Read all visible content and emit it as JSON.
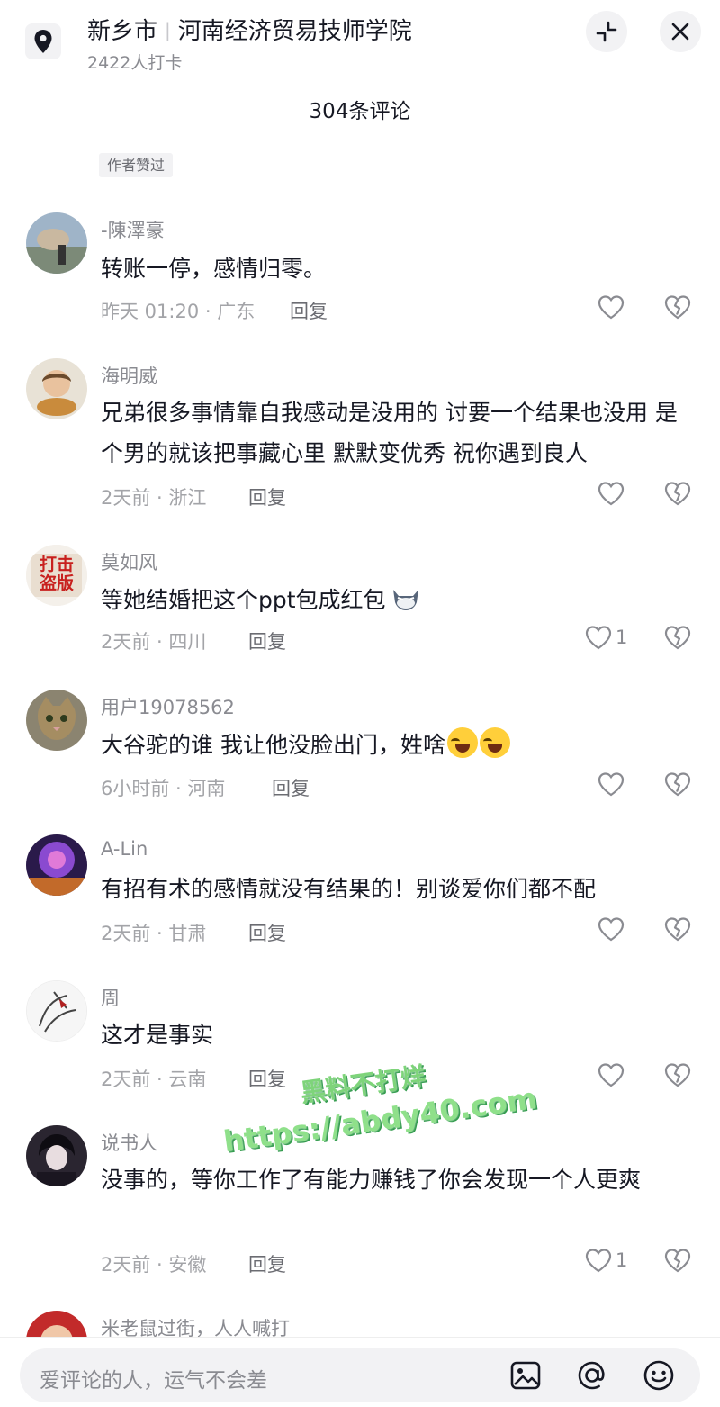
{
  "header": {
    "city": "新乡市",
    "place": "河南经济贸易技师学院",
    "checkins": "2422人打卡",
    "comment_count": "304条评论"
  },
  "author_liked_badge": "作者赞过",
  "comments": [
    {
      "user": "-陳澤豪",
      "text": "转账一停，感情归零。",
      "meta": "昨天 01:20 · 广东",
      "reply": "回复",
      "likes": ""
    },
    {
      "user": "海明威",
      "text": "兄弟很多事情靠自我感动是没用的 讨要一个结果也没用 是个男的就该把事藏心里 默默变优秀 祝你遇到良人",
      "meta": "2天前 · 浙江",
      "reply": "回复",
      "likes": ""
    },
    {
      "user": "莫如风",
      "text": "等她结婚把这个ppt包成红包",
      "meta": "2天前 · 四川",
      "reply": "回复",
      "likes": "1"
    },
    {
      "user": "用户19078562",
      "text": "大谷驼的谁 我让他没脸出门，姓啥",
      "meta": "6小时前 · 河南",
      "reply": "回复",
      "likes": ""
    },
    {
      "user": "A-Lin",
      "text": "有招有术的感情就没有结果的！别谈爱你们都不配",
      "meta": "2天前 · 甘肃",
      "reply": "回复",
      "likes": ""
    },
    {
      "user": "周",
      "text": "这才是事实",
      "meta": "2天前 · 云南",
      "reply": "回复",
      "likes": ""
    },
    {
      "user": "说书人",
      "text": "没事的，等你工作了有能力赚钱了你会发现一个人更爽",
      "meta": "2天前 · 安徽",
      "reply": "回复",
      "likes": "1"
    },
    {
      "user": "米老鼠过街，人人喊打",
      "text": "",
      "meta": "",
      "reply": "",
      "likes": ""
    }
  ],
  "avatar_badge_text": [
    "打击",
    "盗版"
  ],
  "watermark": {
    "line1": "黑料不打烊",
    "line2": "https://abdy40.com"
  },
  "input": {
    "placeholder": "爱评论的人，运气不会差"
  },
  "icons": [
    "location-pin-icon",
    "collapse-icon",
    "close-icon",
    "heart-icon",
    "broken-heart-icon",
    "image-icon",
    "at-icon",
    "emoji-icon"
  ]
}
